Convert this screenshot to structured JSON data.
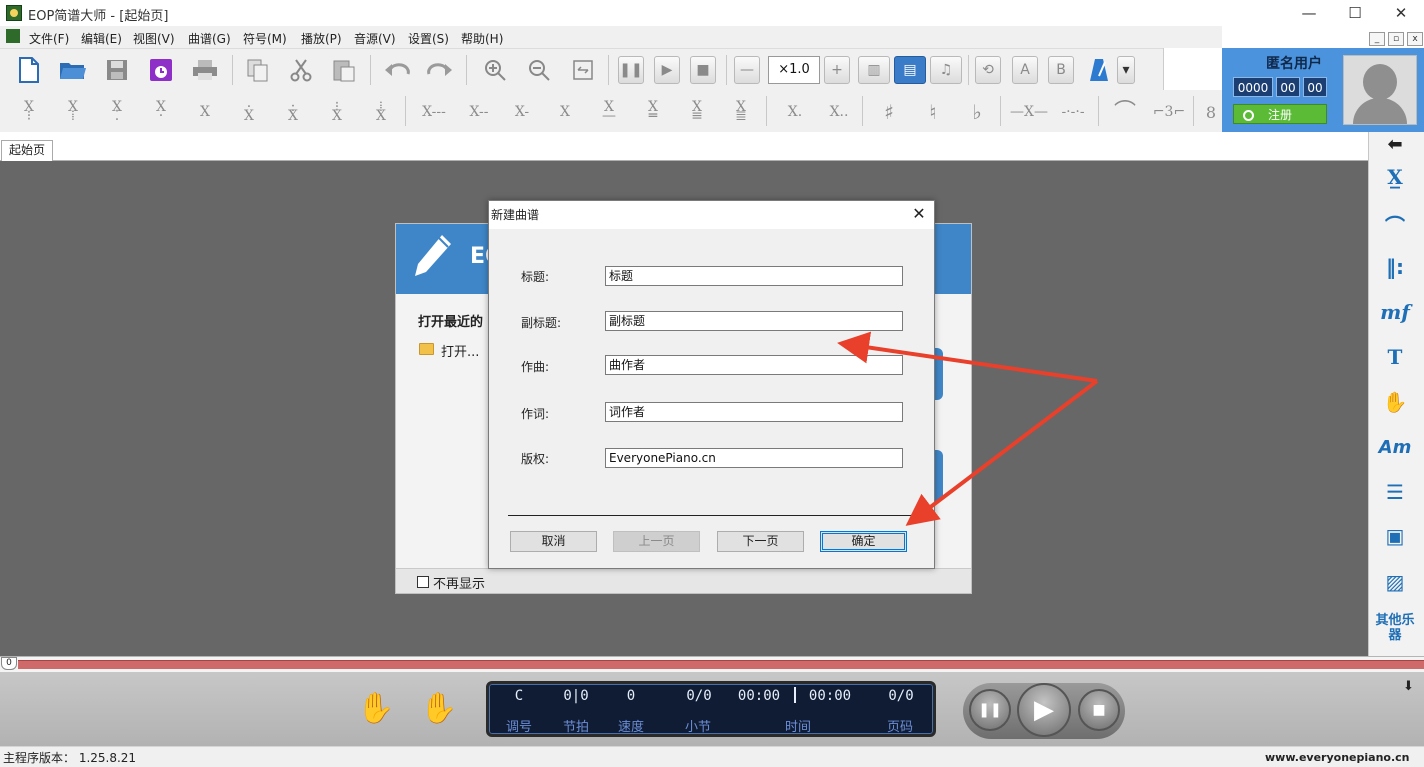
{
  "window": {
    "title": "EOP简谱大师 - [起始页]",
    "minimize": "—",
    "maximize": "☐",
    "close": "✕"
  },
  "menu": [
    "文件(F)",
    "编辑(E)",
    "视图(V)",
    "曲谱(G)",
    "符号(M)",
    "播放(P)",
    "音源(V)",
    "设置(S)",
    "帮助(H)"
  ],
  "toolbar": {
    "speed": "×1.0"
  },
  "note_buttons": [
    "X",
    "X",
    "X",
    "X",
    "X",
    "X",
    "X",
    "X",
    "X",
    "X---",
    "X--",
    "X-",
    "X",
    "X",
    "X",
    "X",
    "X",
    "X.",
    "X..",
    "♯",
    "♮",
    "♭",
    "—X—",
    "-·-·-",
    "⌒",
    "⌐3⌐",
    "8"
  ],
  "user": {
    "name": "匿名用户",
    "count1": "0000",
    "count2": "00",
    "count3": "00",
    "register": "注册"
  },
  "tabs": {
    "start": "起始页"
  },
  "right_panel": {
    "more_instruments": "其他乐器"
  },
  "welcome": {
    "header": "EO",
    "recent_title": "打开最近的",
    "open": "打开...",
    "no_show": "不再显示"
  },
  "dialog": {
    "title": "新建曲谱",
    "fields": [
      {
        "label": "标题:",
        "value": "标题"
      },
      {
        "label": "副标题:",
        "value": "副标题"
      },
      {
        "label": "作曲:",
        "value": "曲作者"
      },
      {
        "label": "作词:",
        "value": "词作者"
      },
      {
        "label": "版权:",
        "value": "EveryonePiano.cn"
      }
    ],
    "buttons": {
      "cancel": "取消",
      "prev": "上一页",
      "next": "下一页",
      "ok": "确定"
    }
  },
  "timeline": {
    "marker": "0"
  },
  "lcd": {
    "values": {
      "key": "C",
      "beat": "0|0",
      "tempo": "0",
      "measure": "0/0",
      "time_current": "00:00",
      "time_total": "00:00",
      "page": "0/0"
    },
    "labels": {
      "key": "调号",
      "beat": "节拍",
      "tempo": "速度",
      "measure": "小节",
      "time": "时间",
      "page": "页码"
    }
  },
  "status": {
    "version": "主程序版本：  1.25.8.21",
    "website": "www.everyonepiano.cn"
  },
  "colors": {
    "accent": "#3f86c8",
    "user_panel": "#4b94dd",
    "register": "#5bbb37",
    "arrow": "#e8402a",
    "timeline": "#cf6a6a",
    "lcd_bg": "#0f1c33"
  }
}
